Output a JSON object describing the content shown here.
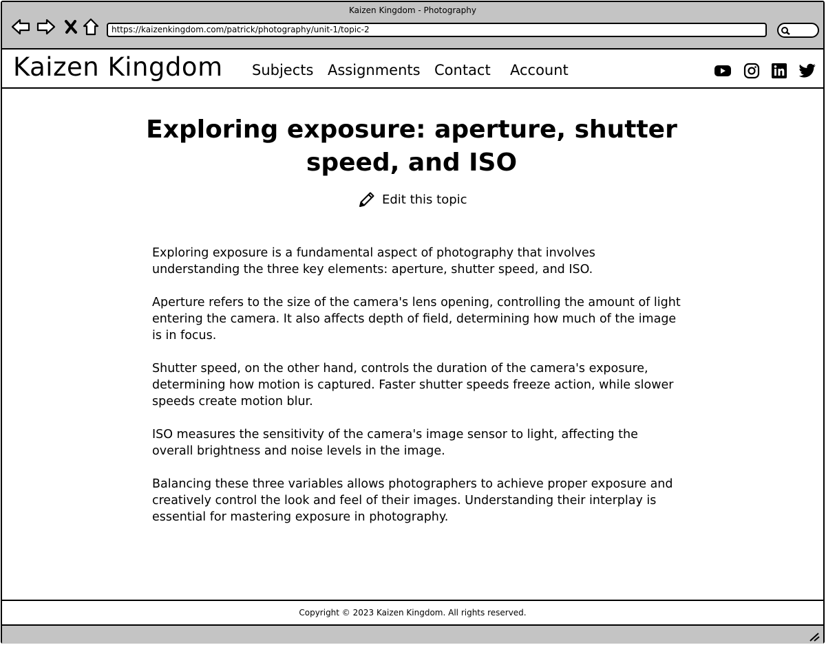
{
  "browser": {
    "window_title": "Kaizen Kingdom - Photography",
    "url": "https://kaizenkingdom.com/patrick/photography/unit-1/topic-2",
    "buttons": {
      "back": "back-arrow-icon",
      "forward": "forward-arrow-icon",
      "stop": "close-icon",
      "home": "home-icon",
      "search": "search-icon"
    }
  },
  "header": {
    "logo": "Kaizen Kingdom",
    "nav": [
      "Subjects",
      "Assignments",
      "Contact",
      "Account"
    ],
    "social_icons": [
      "youtube-icon",
      "instagram-icon",
      "linkedin-icon",
      "twitter-icon"
    ]
  },
  "main": {
    "title": "Exploring exposure: aperture, shutter speed, and ISO",
    "edit_label": "Edit this topic",
    "edit_icon": "pencil-icon",
    "paragraphs": [
      "Exploring exposure is a fundamental aspect of photography that involves understanding the three key elements: aperture, shutter speed, and ISO.",
      "Aperture refers to the size of the camera's lens opening, controlling the amount of light entering the camera. It also affects depth of field, determining how much of the image is in focus.",
      "Shutter speed, on the other hand, controls the duration of the camera's exposure, determining how motion is captured. Faster shutter speeds freeze action, while slower speeds create motion blur.",
      "ISO measures the sensitivity of the camera's image sensor to light, affecting the overall brightness and noise levels in the image.",
      "Balancing these three variables allows photographers to achieve proper exposure and creatively control the look and feel of their images. Understanding their interplay is essential for mastering exposure in photography."
    ]
  },
  "footer": {
    "copyright": "Copyright © 2023 Kaizen Kingdom. All rights reserved."
  },
  "colors": {
    "chrome": "#c4c4c4",
    "border": "#000000",
    "background": "#ffffff"
  }
}
